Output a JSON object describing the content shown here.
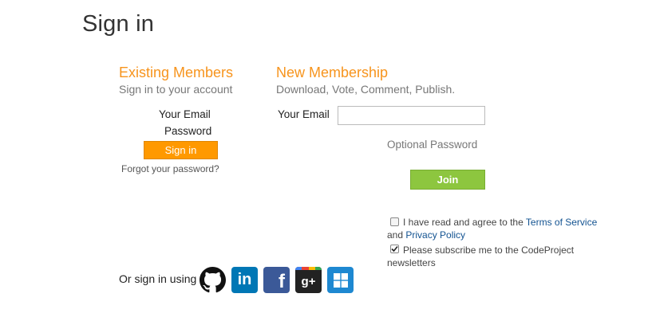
{
  "page": {
    "title": "Sign in"
  },
  "existing": {
    "title": "Existing Members",
    "subtitle": "Sign in to your account",
    "email_label": "Your Email",
    "password_label": "Password",
    "signin_button": "Sign in",
    "forgot_link": "Forgot your password?"
  },
  "newmember": {
    "title": "New Membership",
    "subtitle": "Download, Vote, Comment, Publish.",
    "email_label": "Your Email",
    "email_value": "",
    "password_label": "Optional Password",
    "join_button": "Join",
    "terms_prefix": "I have read and agree to the ",
    "terms_link": "Terms of Service",
    "terms_and": "and ",
    "privacy_link": "Privacy Policy",
    "terms_checked": false,
    "newsletter_line1": "Please subscribe me to the CodeProject",
    "newsletter_line2": "newsletters",
    "newsletter_checked": true
  },
  "social": {
    "label": "Or sign in using",
    "providers": [
      {
        "name": "github-icon",
        "color": "#111111"
      },
      {
        "name": "linkedin-icon",
        "text": "in",
        "color": "#0077b5"
      },
      {
        "name": "facebook-icon",
        "text": "f",
        "color": "#3b5998"
      },
      {
        "name": "google-plus-icon",
        "text": "g+",
        "color": "#222222"
      },
      {
        "name": "windows-icon",
        "color": "#1e88d1"
      }
    ]
  },
  "colors": {
    "accent": "#f7941d",
    "signin_button": "#ff9900",
    "join_button": "#8dc63f",
    "link": "#135391"
  }
}
